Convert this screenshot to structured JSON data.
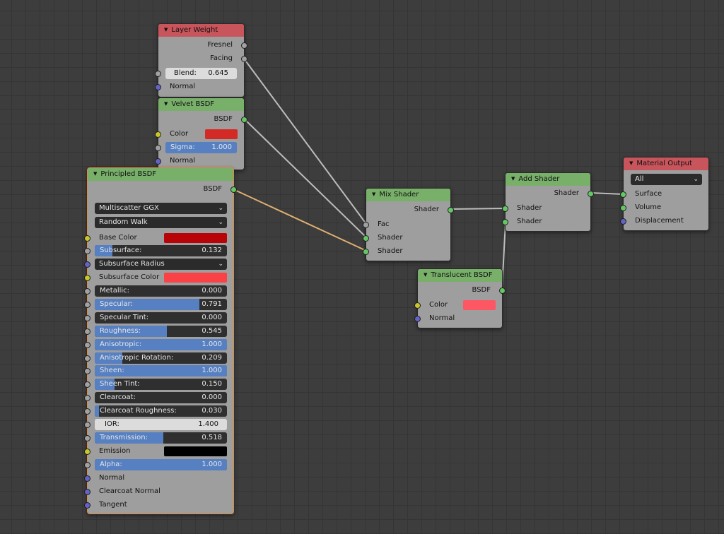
{
  "layer_weight": {
    "title": "Layer Weight",
    "outputs": [
      "Fresnel",
      "Facing"
    ],
    "blend_label": "Blend:",
    "blend_value": "0.645",
    "inputs": [
      "Normal"
    ]
  },
  "velvet_bsdf": {
    "title": "Velvet BSDF",
    "output": "BSDF",
    "color_label": "Color",
    "color": "#d42a26",
    "sigma_label": "Sigma:",
    "sigma_value": "1.000",
    "sigma_fraction": 1.0,
    "normal_label": "Normal"
  },
  "principled_bsdf": {
    "title": "Principled BSDF",
    "output": "BSDF",
    "distribution": "Multiscatter GGX",
    "subsurface_method": "Random Walk",
    "base_color_label": "Base Color",
    "base_color": "#b80309",
    "subsurface_label": "Subsurface:",
    "subsurface_value": "0.132",
    "subsurface_fraction": 0.132,
    "subsurface_radius_label": "Subsurface Radius",
    "subsurface_color_label": "Subsurface Color",
    "subsurface_color": "#fa4146",
    "params": [
      {
        "label": "Metallic:",
        "value": "0.000",
        "fraction": 0.0
      },
      {
        "label": "Specular:",
        "value": "0.791",
        "fraction": 0.791
      },
      {
        "label": "Specular Tint:",
        "value": "0.000",
        "fraction": 0.0
      },
      {
        "label": "Roughness:",
        "value": "0.545",
        "fraction": 0.545
      },
      {
        "label": "Anisotropic:",
        "value": "1.000",
        "fraction": 1.0
      },
      {
        "label": "Anisotropic Rotation:",
        "value": "0.209",
        "fraction": 0.209
      },
      {
        "label": "Sheen:",
        "value": "1.000",
        "fraction": 1.0
      },
      {
        "label": "Sheen Tint:",
        "value": "0.150",
        "fraction": 0.15
      },
      {
        "label": "Clearcoat:",
        "value": "0.000",
        "fraction": 0.0
      },
      {
        "label": "Clearcoat Roughness:",
        "value": "0.030",
        "fraction": 0.03
      }
    ],
    "ior_label": "IOR:",
    "ior_value": "1.400",
    "transmission_label": "Transmission:",
    "transmission_value": "0.518",
    "transmission_fraction": 0.518,
    "emission_label": "Emission",
    "emission_color": "#000000",
    "alpha_label": "Alpha:",
    "alpha_value": "1.000",
    "alpha_fraction": 1.0,
    "normal_label": "Normal",
    "clearcoat_normal_label": "Clearcoat Normal",
    "tangent_label": "Tangent"
  },
  "mix_shader": {
    "title": "Mix Shader",
    "output": "Shader",
    "inputs": [
      "Fac",
      "Shader",
      "Shader"
    ]
  },
  "add_shader": {
    "title": "Add Shader",
    "output": "Shader",
    "inputs": [
      "Shader",
      "Shader"
    ]
  },
  "translucent_bsdf": {
    "title": "Translucent BSDF",
    "output": "BSDF",
    "color_label": "Color",
    "color": "#fd5764",
    "normal_label": "Normal"
  },
  "material_output": {
    "title": "Material Output",
    "target": "All",
    "inputs": [
      "Surface",
      "Volume",
      "Displacement"
    ]
  },
  "colors": {
    "grid_bg": "#3d3d3d",
    "node_body": "#9e9e9e",
    "header_input": "#c8545c",
    "header_shader": "#78b06a",
    "slider_fill": "#5680c2",
    "socket_shader": "#63c763",
    "socket_float": "#a1a1a1",
    "socket_color": "#c7c729",
    "socket_vector": "#6363c7",
    "wire": "#bdbdbd",
    "wire_active": "#e0b070"
  }
}
